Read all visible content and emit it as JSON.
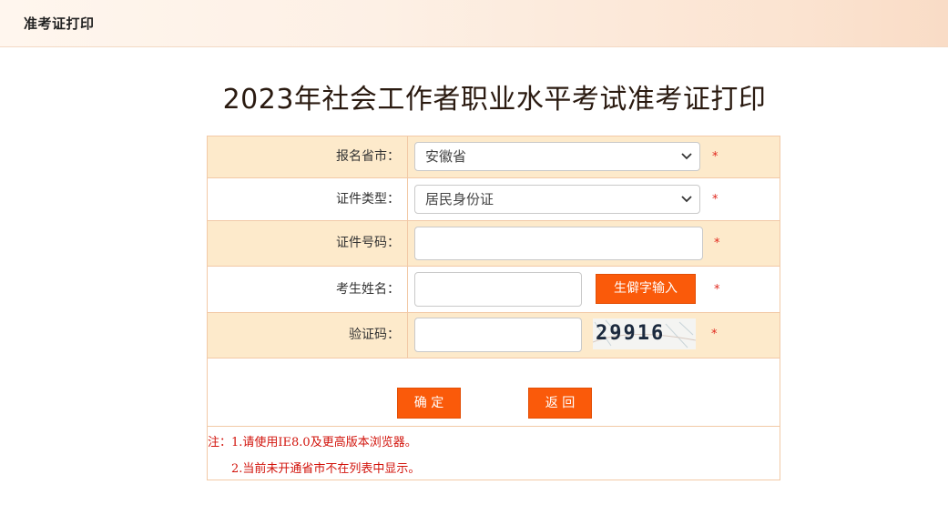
{
  "header": {
    "breadcrumb": "准考证打印"
  },
  "page_title": "2023年社会工作者职业水平考试准考证打印",
  "form": {
    "province": {
      "label": "报名省市：",
      "value": "安徽省"
    },
    "id_type": {
      "label": "证件类型：",
      "value": "居民身份证"
    },
    "id_number": {
      "label": "证件号码：",
      "value": ""
    },
    "name": {
      "label": "考生姓名：",
      "value": "",
      "rare_char_button": "生僻字输入"
    },
    "captcha": {
      "label": "验证码：",
      "value": "",
      "image_text": "29916"
    },
    "required_mark": "*"
  },
  "actions": {
    "confirm": "确 定",
    "back": "返 回"
  },
  "notes": {
    "line1": "注：1.请使用IE8.0及更高版本浏览器。",
    "line2": "2.当前未开通省市不在列表中显示。"
  },
  "colors": {
    "accent": "#fa5a0a",
    "row_shade": "#fdeacb",
    "border": "#f2c9a6",
    "required": "#e0271c",
    "note_text": "#d2140c"
  }
}
